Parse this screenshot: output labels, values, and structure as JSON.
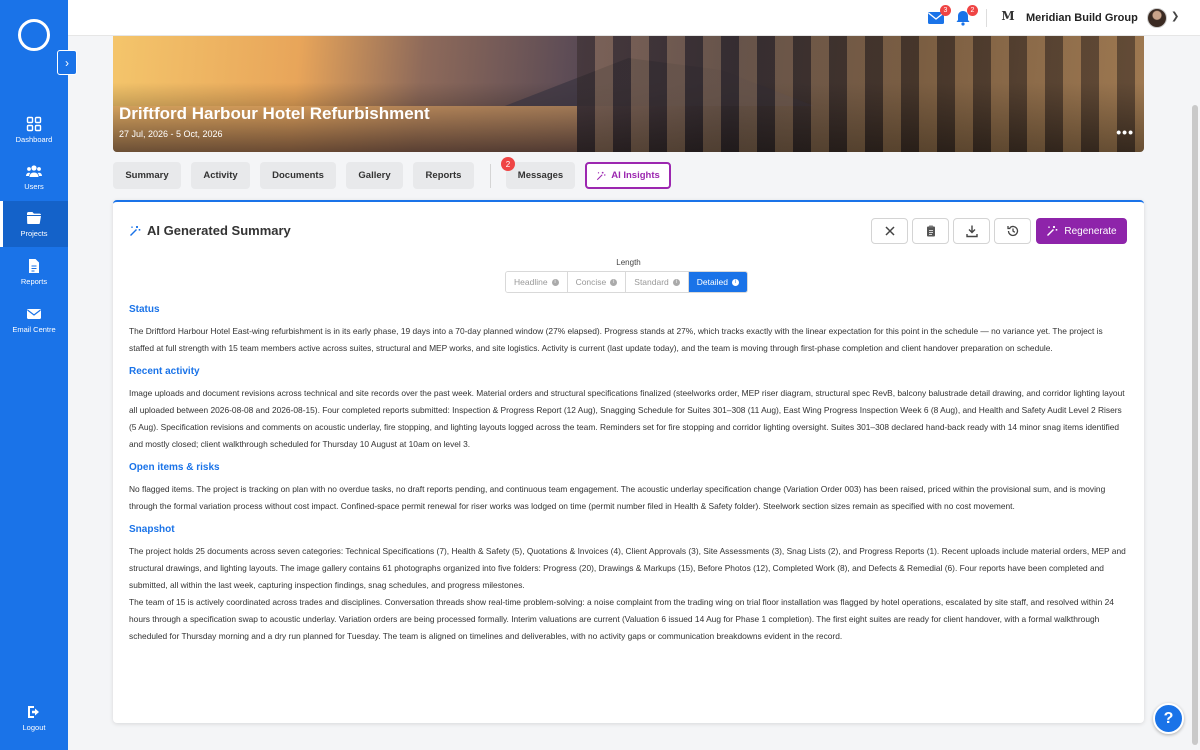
{
  "sidebar": {
    "items": [
      {
        "label": "Dashboard",
        "icon": "grid-icon"
      },
      {
        "label": "Users",
        "icon": "users-icon"
      },
      {
        "label": "Projects",
        "icon": "folder-icon"
      },
      {
        "label": "Reports",
        "icon": "document-icon"
      },
      {
        "label": "Email Centre",
        "icon": "envelope-icon"
      }
    ],
    "logout_label": "Logout"
  },
  "topbar": {
    "mail_badge": "3",
    "bell_badge": "2",
    "company_logo_text": "M",
    "company_name": "Meridian Build Group"
  },
  "project": {
    "title": "Driftford Harbour Hotel Refurbishment",
    "dates": "27 Jul, 2026 - 5 Oct, 2026",
    "more": "•••"
  },
  "tabs": {
    "summary": "Summary",
    "activity": "Activity",
    "documents": "Documents",
    "gallery": "Gallery",
    "reports": "Reports",
    "messages": "Messages",
    "messages_badge": "2",
    "ai_insights": "AI Insights"
  },
  "card": {
    "title": "AI Generated Summary",
    "regenerate_label": "Regenerate",
    "length_label": "Length",
    "length_options": [
      "Headline",
      "Concise",
      "Standard",
      "Detailed"
    ],
    "length_selected": "Detailed"
  },
  "sections": [
    {
      "heading": "Status",
      "body": "The Driftford Harbour Hotel East-wing refurbishment is in its early phase, 19 days into a 70-day planned window (27% elapsed). Progress stands at 27%, which tracks exactly with the linear expectation for this point in the schedule — no variance yet. The project is staffed at full strength with 15 team members active across suites, structural and MEP works, and site logistics. Activity is current (last update today), and the team is moving through first-phase completion and client handover preparation on schedule."
    },
    {
      "heading": "Recent activity",
      "body": "Image uploads and document revisions across technical and site records over the past week. Material orders and structural specifications finalized (steelworks order, MEP riser diagram, structural spec RevB, balcony balustrade detail drawing, and corridor lighting layout all uploaded between 2026-08-08 and 2026-08-15). Four completed reports submitted: Inspection & Progress Report (12 Aug), Snagging Schedule for Suites 301–308 (11 Aug), East Wing Progress Inspection Week 6 (8 Aug), and Health and Safety Audit Level 2 Risers (5 Aug). Specification revisions and comments on acoustic underlay, fire stopping, and lighting layouts logged across the team. Reminders set for fire stopping and corridor lighting oversight. Suites 301–308 declared hand-back ready with 14 minor snag items identified and mostly closed; client walkthrough scheduled for Thursday 10 August at 10am on level 3."
    },
    {
      "heading": "Open items & risks",
      "body": "No flagged items. The project is tracking on plan with no overdue tasks, no draft reports pending, and continuous team engagement. The acoustic underlay specification change (Variation Order 003) has been raised, priced within the provisional sum, and is moving through the formal variation process without cost impact. Confined-space permit renewal for riser works was lodged on time (permit number filed in Health & Safety folder). Steelwork section sizes remain as specified with no cost movement."
    },
    {
      "heading": "Snapshot",
      "body": "The project holds 25 documents across seven categories: Technical Specifications (7), Health & Safety (5), Quotations & Invoices (4), Client Approvals (3), Site Assessments (3), Snag Lists (2), and Progress Reports (1). Recent uploads include material orders, MEP and structural drawings, and lighting layouts. The image gallery contains 61 photographs organized into five folders: Progress (20), Drawings & Markups (15), Before Photos (12), Completed Work (8), and Defects & Remedial (6). Four reports have been completed and submitted, all within the last week, capturing inspection findings, snag schedules, and progress milestones.",
      "body2": "The team of 15 is actively coordinated across trades and disciplines. Conversation threads show real-time problem-solving: a noise complaint from the trading wing on trial floor installation was flagged by hotel operations, escalated by site staff, and resolved within 24 hours through a specification swap to acoustic underlay. Variation orders are being processed formally. Interim valuations are current (Valuation 6 issued 14 Aug for Phase 1 completion). The first eight suites are ready for client handover, with a formal walkthrough scheduled for Thursday morning and a dry run planned for Tuesday. The team is aligned on timelines and deliverables, with no activity gaps or communication breakdowns evident in the record."
    }
  ],
  "help_label": "?",
  "colors": {
    "primary": "#1a73e8",
    "accent_purple": "#8e24aa",
    "badge_red": "#ef4444"
  }
}
